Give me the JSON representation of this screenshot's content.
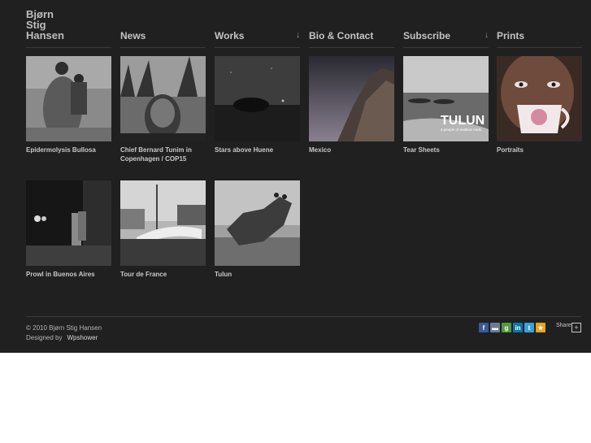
{
  "logo": {
    "line1": "Bjørn",
    "line2": "Stig",
    "line3": "Hansen"
  },
  "nav": [
    {
      "label": "News",
      "arrow": ""
    },
    {
      "label": "Works",
      "arrow": "↓"
    },
    {
      "label": "Bio & Contact",
      "arrow": ""
    },
    {
      "label": "Subscribe",
      "arrow": "↓"
    },
    {
      "label": "Prints",
      "arrow": ""
    }
  ],
  "thumbs": [
    {
      "caption": "Epidermolysis Bullosa"
    },
    {
      "caption": "Chief Bernard Tunim in Copenhagen / COP15"
    },
    {
      "caption": "Stars above Huene"
    },
    {
      "caption": "Mexico"
    },
    {
      "caption": "Tear Sheets",
      "overlay_title": "TULUN",
      "overlay_sub": "a people of endless ends"
    },
    {
      "caption": "Portraits"
    },
    {
      "caption": "Prowl in Buenos Aires"
    },
    {
      "caption": "Tour de France"
    },
    {
      "caption": "Tulun"
    }
  ],
  "footer": {
    "copyright": "© 2010 Bjørn Stig Hansen",
    "designed_by": "Designed by",
    "designer": "Wpshower",
    "share_label": "Share",
    "share_plus": "+",
    "icons": [
      {
        "name": "facebook",
        "glyph": "f",
        "color": "#3b5998"
      },
      {
        "name": "print",
        "glyph": "▬",
        "color": "#6a7b95"
      },
      {
        "name": "google",
        "glyph": "g",
        "color": "#4f9a3c"
      },
      {
        "name": "linkedin",
        "glyph": "in",
        "color": "#0e76a8"
      },
      {
        "name": "twitter",
        "glyph": "t",
        "color": "#3aa0dc"
      },
      {
        "name": "favorite",
        "glyph": "★",
        "color": "#e8a11c"
      }
    ]
  }
}
